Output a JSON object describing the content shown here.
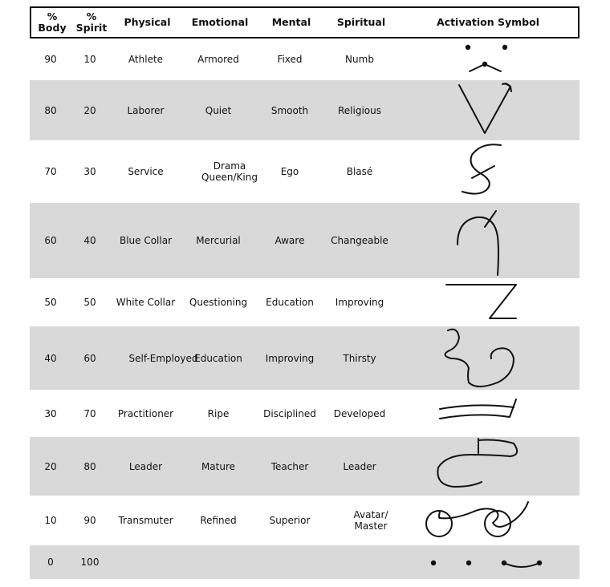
{
  "table": {
    "headers": [
      "% Body",
      "% Spirit",
      "Physical",
      "Emotional",
      "Mental",
      "Spiritual",
      "Activation Symbol"
    ],
    "header_lines": [
      [
        "%",
        "Body"
      ],
      [
        "%",
        "Spirit"
      ]
    ],
    "rows": [
      {
        "body": "90",
        "spirit": "10",
        "physical": "Athlete",
        "emotional": "Armored",
        "mental": "Fixed",
        "spiritual": "Numb",
        "symbol": "dots-with-caret-symbol"
      },
      {
        "body": "80",
        "spirit": "20",
        "physical": "Laborer",
        "emotional": "Quiet",
        "mental": "Smooth",
        "spiritual": "Religious",
        "symbol": "v-check-symbol"
      },
      {
        "body": "70",
        "spirit": "30",
        "physical": "Service",
        "emotional": "Drama Queen/King",
        "mental": "Ego",
        "spiritual": "Blasé",
        "symbol": "crossed-s-symbol"
      },
      {
        "body": "60",
        "spirit": "40",
        "physical": "Blue Collar",
        "emotional": "Mercurial",
        "mental": "Aware",
        "spiritual": "Changeable",
        "symbol": "crossed-hook-symbol"
      },
      {
        "body": "50",
        "spirit": "50",
        "physical": "White Collar",
        "emotional": "Questioning",
        "mental": "Education",
        "spiritual": "Improving",
        "symbol": "z-symbol"
      },
      {
        "body": "40",
        "spirit": "60",
        "physical": "Self-Employed",
        "emotional": "Education",
        "mental": "Improving",
        "spiritual": "Thirsty",
        "symbol": "wave-spiral-symbol"
      },
      {
        "body": "30",
        "spirit": "70",
        "physical": "Practitioner",
        "emotional": "Ripe",
        "mental": "Disciplined",
        "spiritual": "Developed",
        "symbol": "double-line-slash-symbol"
      },
      {
        "body": "20",
        "spirit": "80",
        "physical": "Leader",
        "emotional": "Mature",
        "mental": "Teacher",
        "spiritual": "Leader",
        "symbol": "loop-with-t-symbol"
      },
      {
        "body": "10",
        "spirit": "90",
        "physical": "Transmuter",
        "emotional": "Refined",
        "mental": "Superior",
        "spiritual": "Avatar/ Master",
        "symbol": "two-circles-symbol"
      },
      {
        "body": "0",
        "spirit": "100",
        "physical": "",
        "emotional": "",
        "mental": "",
        "spiritual": "",
        "symbol": "dots-with-smile-symbol"
      }
    ]
  }
}
